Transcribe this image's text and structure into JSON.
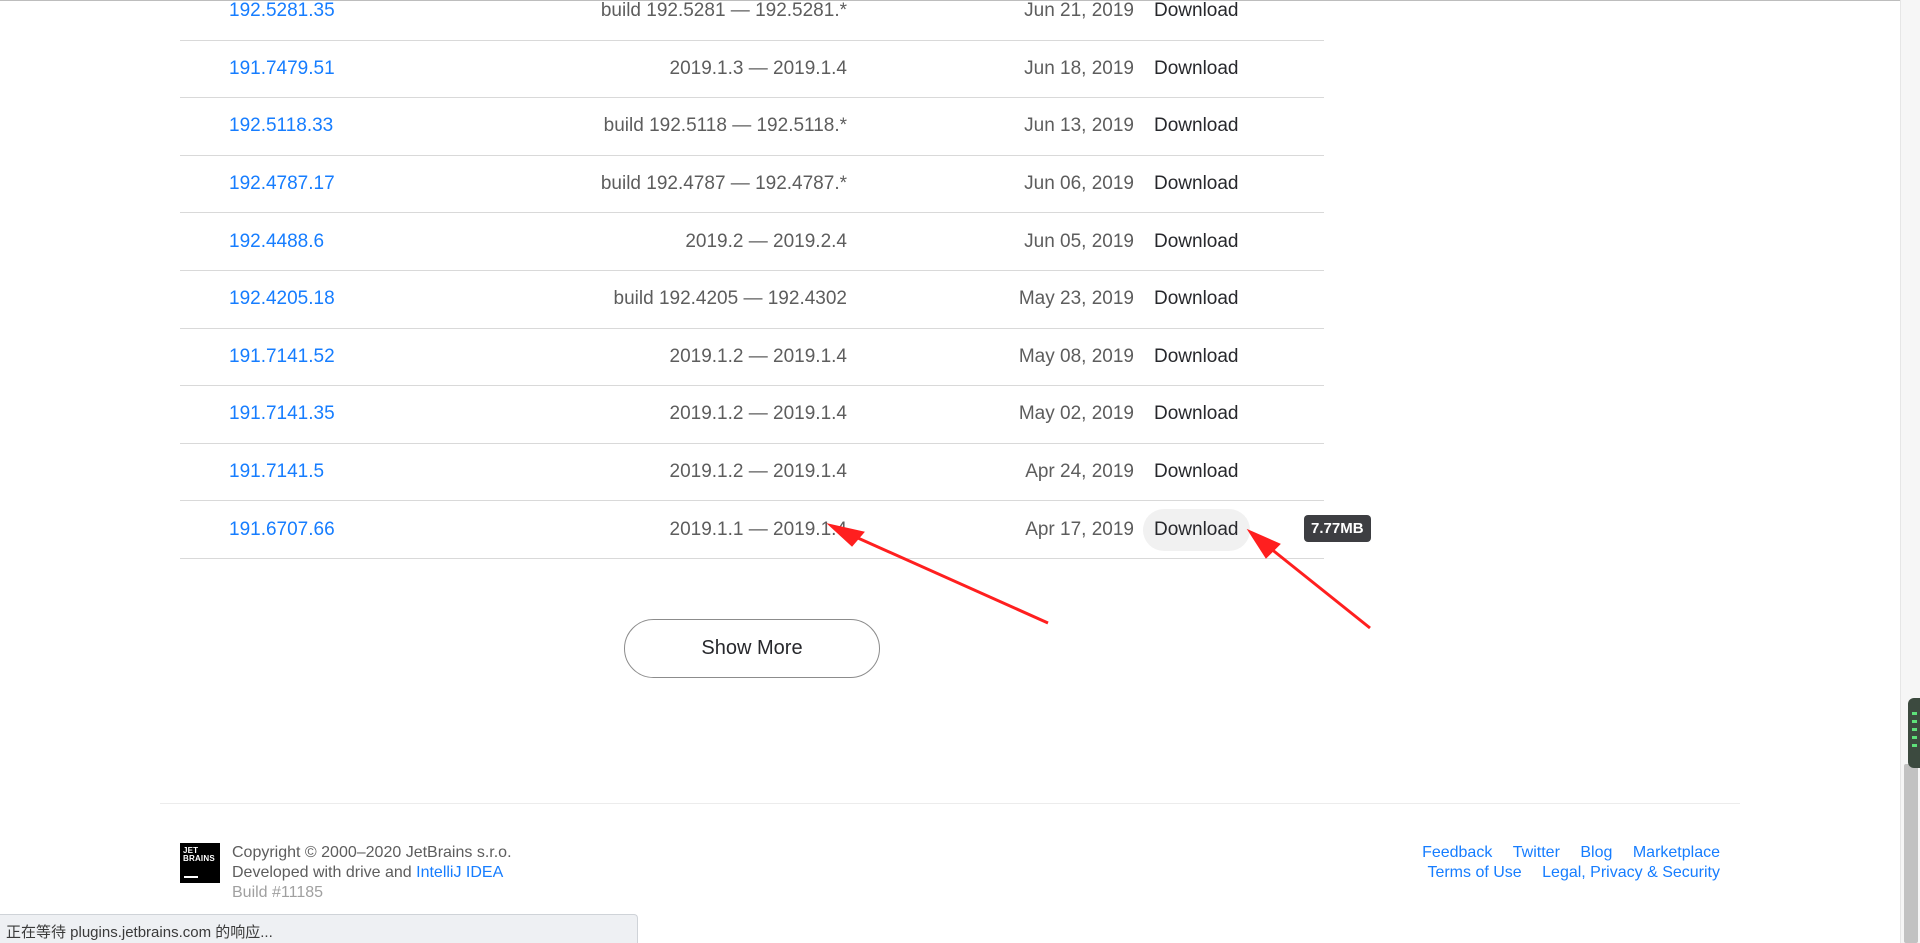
{
  "versions": [
    {
      "version": "192.5281.35",
      "compat": "build 192.5281 — 192.5281.*",
      "date": "Jun 21, 2019",
      "action": "Download"
    },
    {
      "version": "191.7479.51",
      "compat": "2019.1.3 — 2019.1.4",
      "date": "Jun 18, 2019",
      "action": "Download"
    },
    {
      "version": "192.5118.33",
      "compat": "build 192.5118 — 192.5118.*",
      "date": "Jun 13, 2019",
      "action": "Download"
    },
    {
      "version": "192.4787.17",
      "compat": "build 192.4787 — 192.4787.*",
      "date": "Jun 06, 2019",
      "action": "Download"
    },
    {
      "version": "192.4488.6",
      "compat": "2019.2 — 2019.2.4",
      "date": "Jun 05, 2019",
      "action": "Download"
    },
    {
      "version": "192.4205.18",
      "compat": "build 192.4205 — 192.4302",
      "date": "May 23, 2019",
      "action": "Download"
    },
    {
      "version": "191.7141.52",
      "compat": "2019.1.2 — 2019.1.4",
      "date": "May 08, 2019",
      "action": "Download"
    },
    {
      "version": "191.7141.35",
      "compat": "2019.1.2 — 2019.1.4",
      "date": "May 02, 2019",
      "action": "Download"
    },
    {
      "version": "191.7141.5",
      "compat": "2019.1.2 — 2019.1.4",
      "date": "Apr 24, 2019",
      "action": "Download"
    },
    {
      "version": "191.6707.66",
      "compat": "2019.1.1 — 2019.1.4",
      "date": "Apr 17, 2019",
      "action": "Download"
    }
  ],
  "tooltip": "7.77MB",
  "show_more_label": "Show More",
  "footer": {
    "logo_line1": "JET",
    "logo_line2": "BRAINS",
    "copyright": "Copyright © 2000–2020 JetBrains s.r.o.",
    "developed_prefix": "Developed with drive and",
    "developed_link": "IntelliJ IDEA",
    "build": "Build #11185",
    "links_row1": [
      "Feedback",
      "Twitter",
      "Blog",
      "Marketplace"
    ],
    "links_row2": [
      "Terms of Use",
      "Legal, Privacy & Security"
    ]
  },
  "status_text": "正在等待 plugins.jetbrains.com 的响应...",
  "colors": {
    "link": "#167dff",
    "annotation_arrow": "#ff1f1f",
    "tooltip_bg": "#3d3e42"
  },
  "icons": [
    "jetbrains-logo-icon",
    "red-arrow-annotation-icon"
  ]
}
